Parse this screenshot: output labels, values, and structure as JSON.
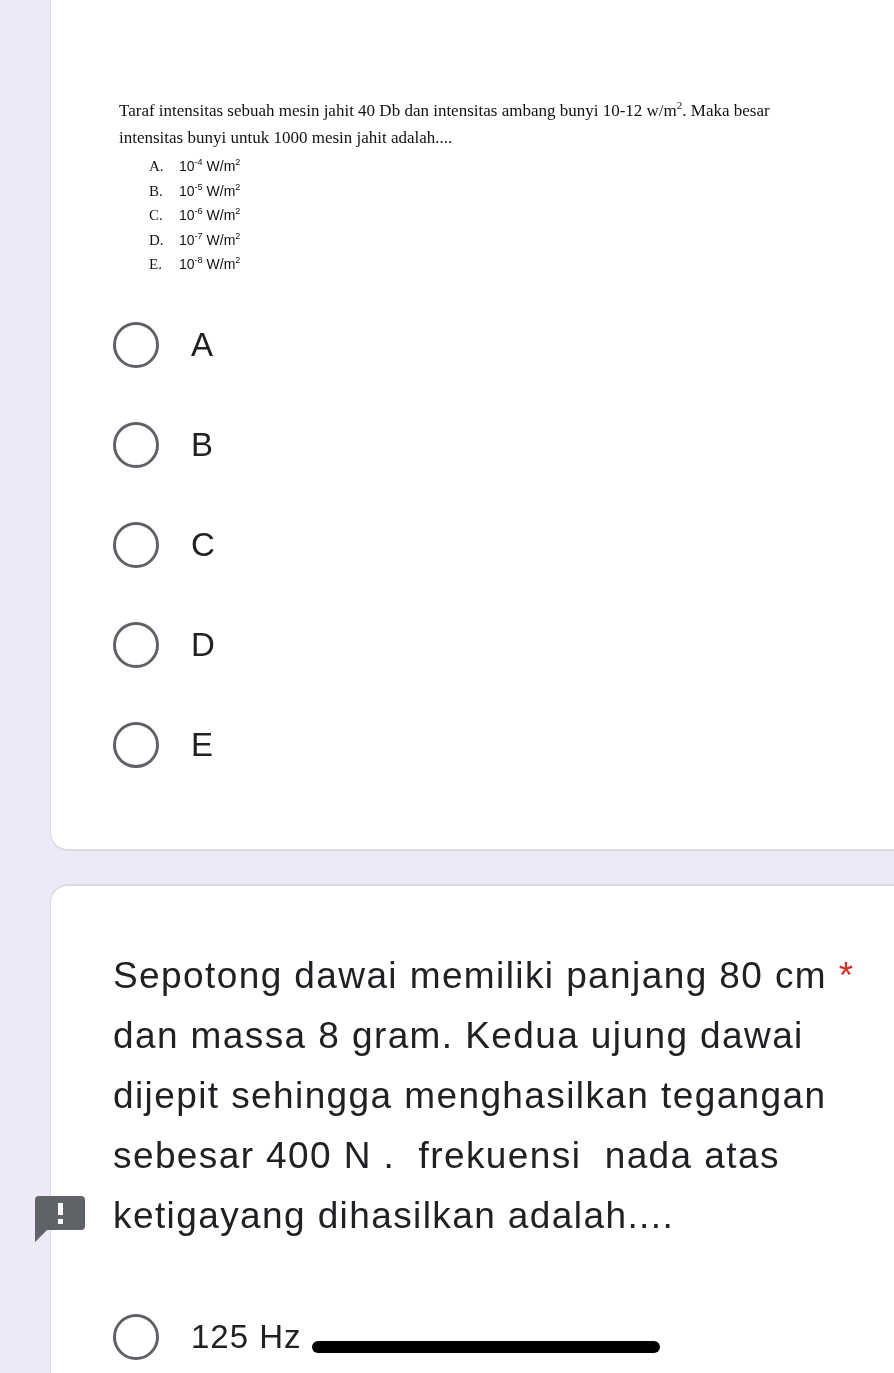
{
  "question_1": {
    "image": {
      "text": "Taraf intensitas sebuah mesin jahit 40 Db dan intensitas ambang bunyi 10-12 w/m$^{2}$. Maka besar intensitas bunyi untuk 1000 mesin jahit adalah....",
      "choices": [
        {
          "letter": "A.",
          "value": "10$^{-4}$ W/m$^{2}$"
        },
        {
          "letter": "B.",
          "value": "10$^{-5}$ W/m$^{2}$"
        },
        {
          "letter": "C.",
          "value": "10$^{-6}$ W/m$^{2}$"
        },
        {
          "letter": "D.",
          "value": "10$^{-7}$ W/m$^{2}$"
        },
        {
          "letter": "E.",
          "value": "10$^{-8}$ W/m$^{2}$"
        }
      ]
    },
    "options": [
      {
        "label": "A",
        "selected": false
      },
      {
        "label": "B",
        "selected": false
      },
      {
        "label": "C",
        "selected": false
      },
      {
        "label": "D",
        "selected": false
      },
      {
        "label": "E",
        "selected": false
      }
    ]
  },
  "question_2": {
    "text": "Sepotong dawai memiliki panjang 80 cm",
    "required_mark": "*",
    "text_2": "dan massa 8 gram. Kedua ujung dawai dijepit sehingga menghasilkan tegangan sebesar 400 N .  frekuensi  nada atas ketigayang dihasilkan adalah....",
    "warning": true,
    "options": [
      {
        "label": "125 Hz",
        "selected": false
      }
    ]
  }
}
